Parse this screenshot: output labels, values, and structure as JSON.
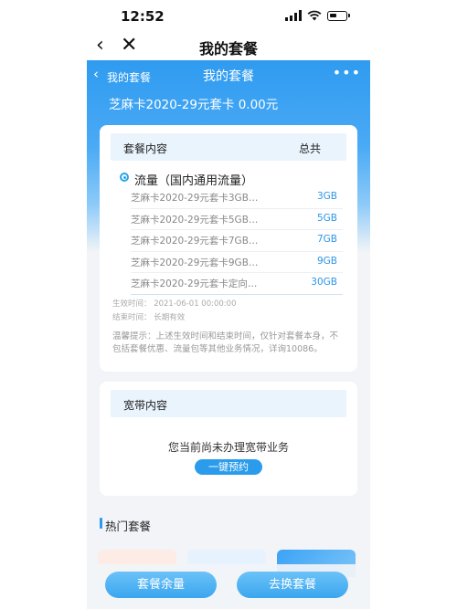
{
  "statusbar": {
    "time": "12:52"
  },
  "navbar": {
    "back_icon": "‹",
    "close_icon": "✕",
    "title": "我的套餐"
  },
  "header": {
    "back_icon": "‹",
    "back_label": "我的套餐",
    "title": "我的套餐",
    "more_icon": "•••",
    "plan_line": "芝麻卡2020-29元套卡 0.00元"
  },
  "package_card": {
    "head_left": "套餐内容",
    "head_right": "总共",
    "category": "流量（国内通用流量）",
    "items": [
      {
        "name": "芝麻卡2020-29元套卡3GB…",
        "value": "3GB"
      },
      {
        "name": "芝麻卡2020-29元套卡5GB…",
        "value": "5GB"
      },
      {
        "name": "芝麻卡2020-29元套卡7GB…",
        "value": "7GB"
      },
      {
        "name": "芝麻卡2020-29元套卡9GB…",
        "value": "9GB"
      },
      {
        "name": "芝麻卡2020-29元套卡定向…",
        "value": "30GB"
      }
    ],
    "effective": "生效时间： 2021-06-01 00:00:00",
    "end": "结束时间： 长期有效",
    "tip": "温馨提示：上述生效时间和结束时间，仅针对套餐本身，不包括套餐优惠、流量包等其他业务情况，详询10086。"
  },
  "broadband_card": {
    "head": "宽带内容",
    "message": "您当前尚未办理宽带业务",
    "button": "一键预约"
  },
  "hot": {
    "title": "热门套餐"
  },
  "bottom": {
    "left_button": "套餐余量",
    "right_button": "去换套餐"
  },
  "colors": {
    "accent": "#2a9ceb",
    "header": "#2f9bf0",
    "value_blue": "#2f95e6"
  }
}
